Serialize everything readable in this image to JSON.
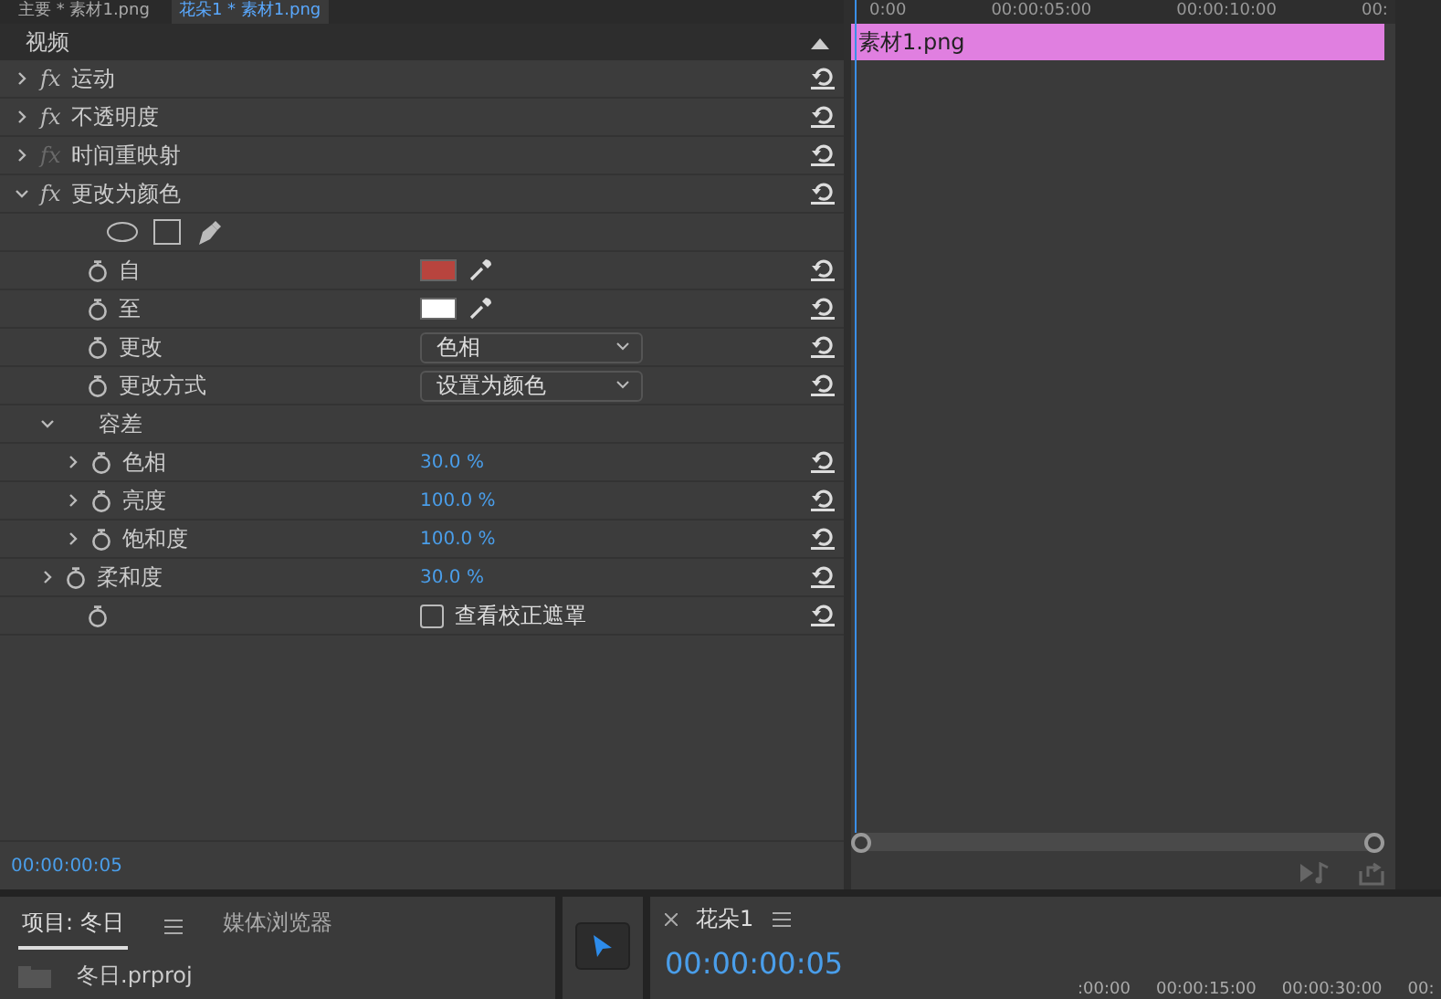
{
  "top_tabs": [
    {
      "label": "主要 * 素材1.png",
      "selected": false
    },
    {
      "label": "花朵1 * 素材1.png",
      "selected": true
    }
  ],
  "ruler": [
    "0:00",
    "00:00:05:00",
    "00:00:10:00",
    "00:"
  ],
  "section": {
    "title": "视频",
    "expanded": true
  },
  "clip": {
    "label": "素材1.png",
    "color": "#e07fe0"
  },
  "effects": [
    {
      "kind": "effect",
      "icon": "fx",
      "label": "运动",
      "expanded": false,
      "disabled": false
    },
    {
      "kind": "effect",
      "icon": "fx",
      "label": "不透明度",
      "expanded": false,
      "disabled": false
    },
    {
      "kind": "effect",
      "icon": "fx",
      "label": "时间重映射",
      "expanded": false,
      "disabled": true
    },
    {
      "kind": "effect",
      "icon": "fx",
      "label": "更改为颜色",
      "expanded": true,
      "disabled": false,
      "children": [
        {
          "kind": "masks"
        },
        {
          "kind": "color",
          "label": "自",
          "color": "#b8443e"
        },
        {
          "kind": "color",
          "label": "至",
          "color": "#ffffff"
        },
        {
          "kind": "dropdown",
          "label": "更改",
          "value": "色相"
        },
        {
          "kind": "dropdown",
          "label": "更改方式",
          "value": "设置为颜色"
        },
        {
          "kind": "group",
          "label": "容差",
          "expanded": true,
          "children": [
            {
              "kind": "percent",
              "label": "色相",
              "value": "30.0 %",
              "expanded": false
            },
            {
              "kind": "percent",
              "label": "亮度",
              "value": "100.0 %",
              "expanded": false
            },
            {
              "kind": "percent",
              "label": "饱和度",
              "value": "100.0 %",
              "expanded": false
            }
          ]
        },
        {
          "kind": "percent",
          "label": "柔和度",
          "value": "30.0 %",
          "expanded": false
        },
        {
          "kind": "checkbox",
          "label": "查看校正遮罩",
          "checked": false
        }
      ]
    }
  ],
  "status_time": "00:00:00:05",
  "project_tabs": [
    {
      "label": "项目: 冬日",
      "selected": true
    },
    {
      "label": "媒体浏览器",
      "selected": false
    }
  ],
  "project_items": [
    {
      "name": "冬日.prproj"
    }
  ],
  "sequence": {
    "title": "花朵1",
    "timecode": "00:00:00:05",
    "ruler": [
      ":00:00",
      "00:00:15:00",
      "00:00:30:00",
      "00:"
    ]
  }
}
